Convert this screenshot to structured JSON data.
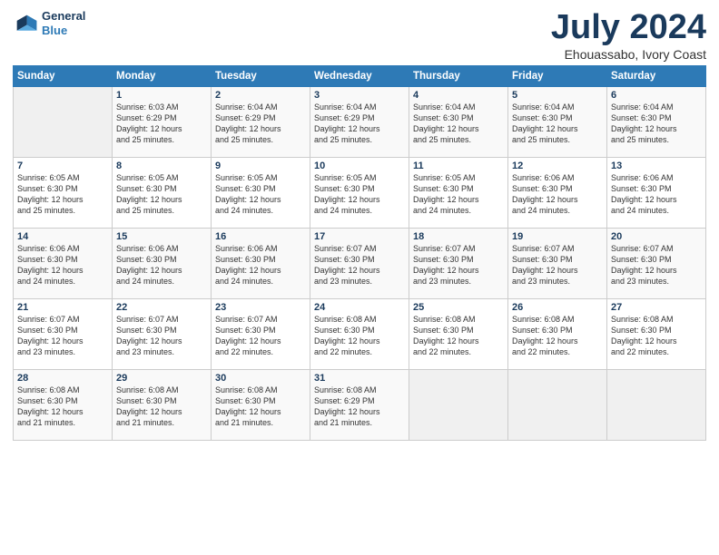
{
  "header": {
    "logo_line1": "General",
    "logo_line2": "Blue",
    "month": "July 2024",
    "location": "Ehouassabo, Ivory Coast"
  },
  "weekdays": [
    "Sunday",
    "Monday",
    "Tuesday",
    "Wednesday",
    "Thursday",
    "Friday",
    "Saturday"
  ],
  "weeks": [
    [
      {
        "day": "",
        "info": ""
      },
      {
        "day": "1",
        "info": "Sunrise: 6:03 AM\nSunset: 6:29 PM\nDaylight: 12 hours\nand 25 minutes."
      },
      {
        "day": "2",
        "info": "Sunrise: 6:04 AM\nSunset: 6:29 PM\nDaylight: 12 hours\nand 25 minutes."
      },
      {
        "day": "3",
        "info": "Sunrise: 6:04 AM\nSunset: 6:29 PM\nDaylight: 12 hours\nand 25 minutes."
      },
      {
        "day": "4",
        "info": "Sunrise: 6:04 AM\nSunset: 6:30 PM\nDaylight: 12 hours\nand 25 minutes."
      },
      {
        "day": "5",
        "info": "Sunrise: 6:04 AM\nSunset: 6:30 PM\nDaylight: 12 hours\nand 25 minutes."
      },
      {
        "day": "6",
        "info": "Sunrise: 6:04 AM\nSunset: 6:30 PM\nDaylight: 12 hours\nand 25 minutes."
      }
    ],
    [
      {
        "day": "7",
        "info": "Sunrise: 6:05 AM\nSunset: 6:30 PM\nDaylight: 12 hours\nand 25 minutes."
      },
      {
        "day": "8",
        "info": "Sunrise: 6:05 AM\nSunset: 6:30 PM\nDaylight: 12 hours\nand 25 minutes."
      },
      {
        "day": "9",
        "info": "Sunrise: 6:05 AM\nSunset: 6:30 PM\nDaylight: 12 hours\nand 24 minutes."
      },
      {
        "day": "10",
        "info": "Sunrise: 6:05 AM\nSunset: 6:30 PM\nDaylight: 12 hours\nand 24 minutes."
      },
      {
        "day": "11",
        "info": "Sunrise: 6:05 AM\nSunset: 6:30 PM\nDaylight: 12 hours\nand 24 minutes."
      },
      {
        "day": "12",
        "info": "Sunrise: 6:06 AM\nSunset: 6:30 PM\nDaylight: 12 hours\nand 24 minutes."
      },
      {
        "day": "13",
        "info": "Sunrise: 6:06 AM\nSunset: 6:30 PM\nDaylight: 12 hours\nand 24 minutes."
      }
    ],
    [
      {
        "day": "14",
        "info": "Sunrise: 6:06 AM\nSunset: 6:30 PM\nDaylight: 12 hours\nand 24 minutes."
      },
      {
        "day": "15",
        "info": "Sunrise: 6:06 AM\nSunset: 6:30 PM\nDaylight: 12 hours\nand 24 minutes."
      },
      {
        "day": "16",
        "info": "Sunrise: 6:06 AM\nSunset: 6:30 PM\nDaylight: 12 hours\nand 24 minutes."
      },
      {
        "day": "17",
        "info": "Sunrise: 6:07 AM\nSunset: 6:30 PM\nDaylight: 12 hours\nand 23 minutes."
      },
      {
        "day": "18",
        "info": "Sunrise: 6:07 AM\nSunset: 6:30 PM\nDaylight: 12 hours\nand 23 minutes."
      },
      {
        "day": "19",
        "info": "Sunrise: 6:07 AM\nSunset: 6:30 PM\nDaylight: 12 hours\nand 23 minutes."
      },
      {
        "day": "20",
        "info": "Sunrise: 6:07 AM\nSunset: 6:30 PM\nDaylight: 12 hours\nand 23 minutes."
      }
    ],
    [
      {
        "day": "21",
        "info": "Sunrise: 6:07 AM\nSunset: 6:30 PM\nDaylight: 12 hours\nand 23 minutes."
      },
      {
        "day": "22",
        "info": "Sunrise: 6:07 AM\nSunset: 6:30 PM\nDaylight: 12 hours\nand 23 minutes."
      },
      {
        "day": "23",
        "info": "Sunrise: 6:07 AM\nSunset: 6:30 PM\nDaylight: 12 hours\nand 22 minutes."
      },
      {
        "day": "24",
        "info": "Sunrise: 6:08 AM\nSunset: 6:30 PM\nDaylight: 12 hours\nand 22 minutes."
      },
      {
        "day": "25",
        "info": "Sunrise: 6:08 AM\nSunset: 6:30 PM\nDaylight: 12 hours\nand 22 minutes."
      },
      {
        "day": "26",
        "info": "Sunrise: 6:08 AM\nSunset: 6:30 PM\nDaylight: 12 hours\nand 22 minutes."
      },
      {
        "day": "27",
        "info": "Sunrise: 6:08 AM\nSunset: 6:30 PM\nDaylight: 12 hours\nand 22 minutes."
      }
    ],
    [
      {
        "day": "28",
        "info": "Sunrise: 6:08 AM\nSunset: 6:30 PM\nDaylight: 12 hours\nand 21 minutes."
      },
      {
        "day": "29",
        "info": "Sunrise: 6:08 AM\nSunset: 6:30 PM\nDaylight: 12 hours\nand 21 minutes."
      },
      {
        "day": "30",
        "info": "Sunrise: 6:08 AM\nSunset: 6:30 PM\nDaylight: 12 hours\nand 21 minutes."
      },
      {
        "day": "31",
        "info": "Sunrise: 6:08 AM\nSunset: 6:29 PM\nDaylight: 12 hours\nand 21 minutes."
      },
      {
        "day": "",
        "info": ""
      },
      {
        "day": "",
        "info": ""
      },
      {
        "day": "",
        "info": ""
      }
    ]
  ]
}
